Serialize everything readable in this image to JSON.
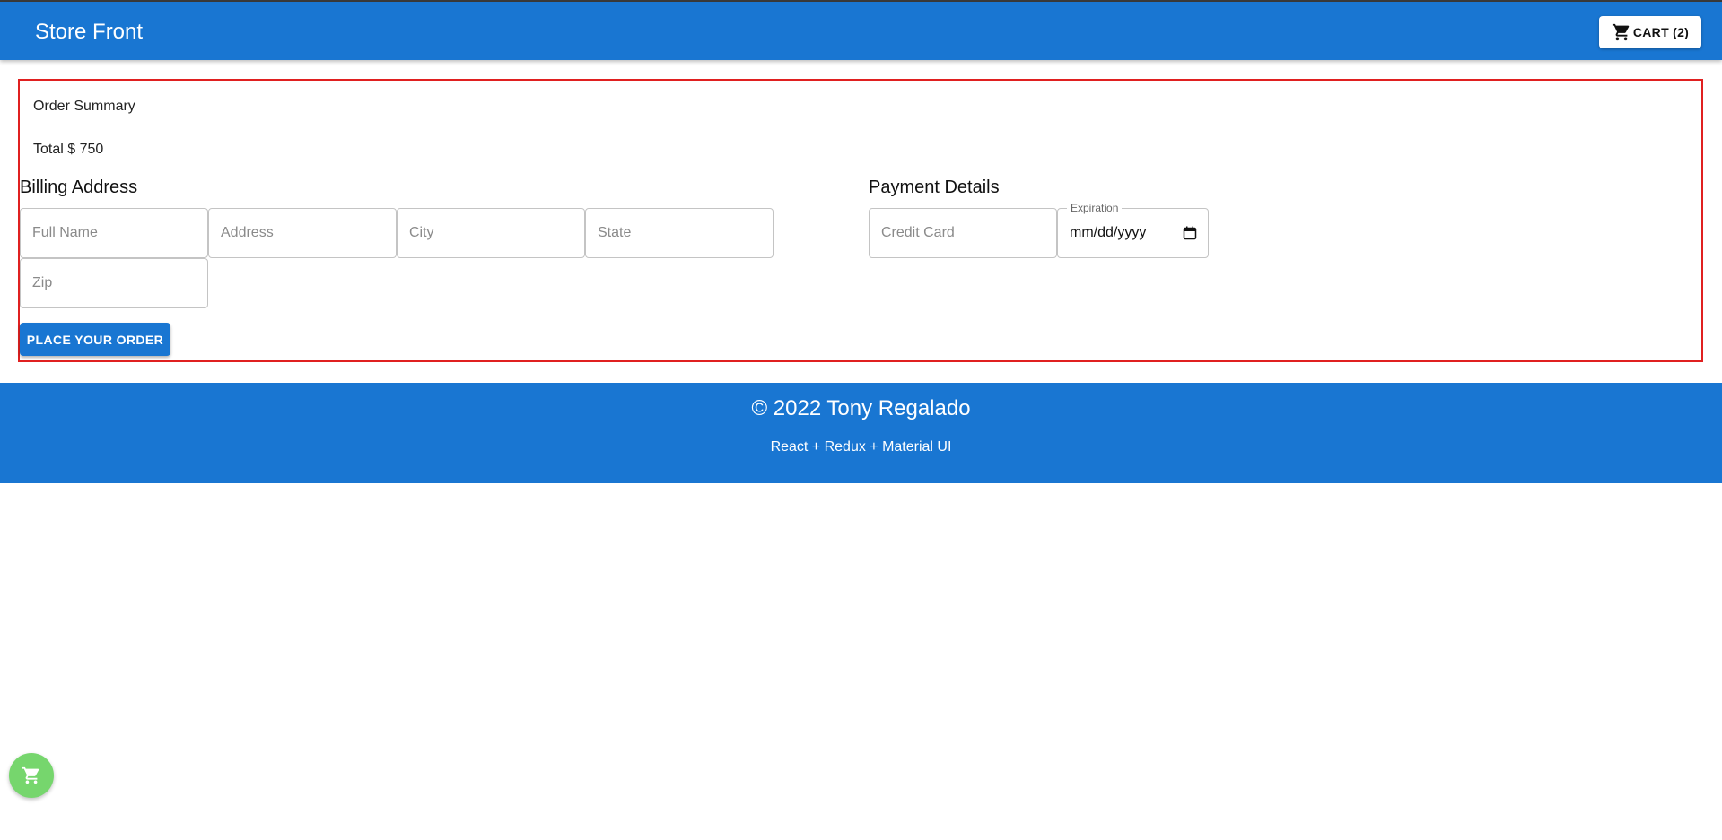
{
  "appbar": {
    "title": "Store Front",
    "cart_label": "CART (2)",
    "cart_icon": "shopping-cart-icon"
  },
  "summary": {
    "title": "Order Summary",
    "total": "Total $ 750"
  },
  "billing": {
    "heading": "Billing Address",
    "full_name_placeholder": "Full Name",
    "address_placeholder": "Address",
    "city_placeholder": "City",
    "state_placeholder": "State",
    "zip_placeholder": "Zip"
  },
  "payment": {
    "heading": "Payment Details",
    "credit_card_placeholder": "Credit Card",
    "expiration_label": "Expiration",
    "expiration_value": "mm/dd/yyyy",
    "calendar_icon": "calendar-icon"
  },
  "actions": {
    "place_order_label": "PLACE YOUR ORDER"
  },
  "footer": {
    "copyright": "© 2022 Tony Regalado",
    "tech": "React + Redux + Material UI"
  },
  "fab": {
    "icon": "shopping-cart-icon"
  },
  "colors": {
    "primary": "#1976d2",
    "order_box_border": "#e02020",
    "fab": "#76d66d"
  }
}
